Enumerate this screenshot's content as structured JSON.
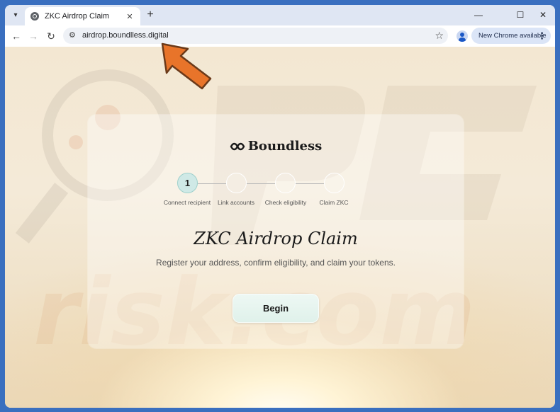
{
  "browser": {
    "tab": {
      "title": "ZKC Airdrop Claim",
      "close_glyph": "✕",
      "favicon_icon": "globe-icon"
    },
    "newtab_glyph": "+",
    "window_controls": {
      "minimize": "—",
      "maximize": "☐",
      "close": "✕"
    },
    "nav": {
      "back": "←",
      "forward": "→",
      "reload": "↻"
    },
    "url": "airdrop.boundlless.digital",
    "star_glyph": "☆",
    "site_info_glyph": "⚙",
    "update_chip": "New Chrome available",
    "kebab_glyph": "⋮"
  },
  "page": {
    "brand": "Boundless",
    "steps": [
      {
        "number": "1",
        "label": "Connect recipient",
        "active": true
      },
      {
        "number": "",
        "label": "Link accounts",
        "active": false
      },
      {
        "number": "",
        "label": "Check eligibility",
        "active": false
      },
      {
        "number": "",
        "label": "Claim ZKC",
        "active": false
      }
    ],
    "title": "ZKC Airdrop Claim",
    "subtitle": "Register your address, confirm eligibility, and claim your tokens.",
    "begin_button": "Begin"
  },
  "colors": {
    "accent_step": "#cfe9e6",
    "arrow": "#e8742a"
  }
}
